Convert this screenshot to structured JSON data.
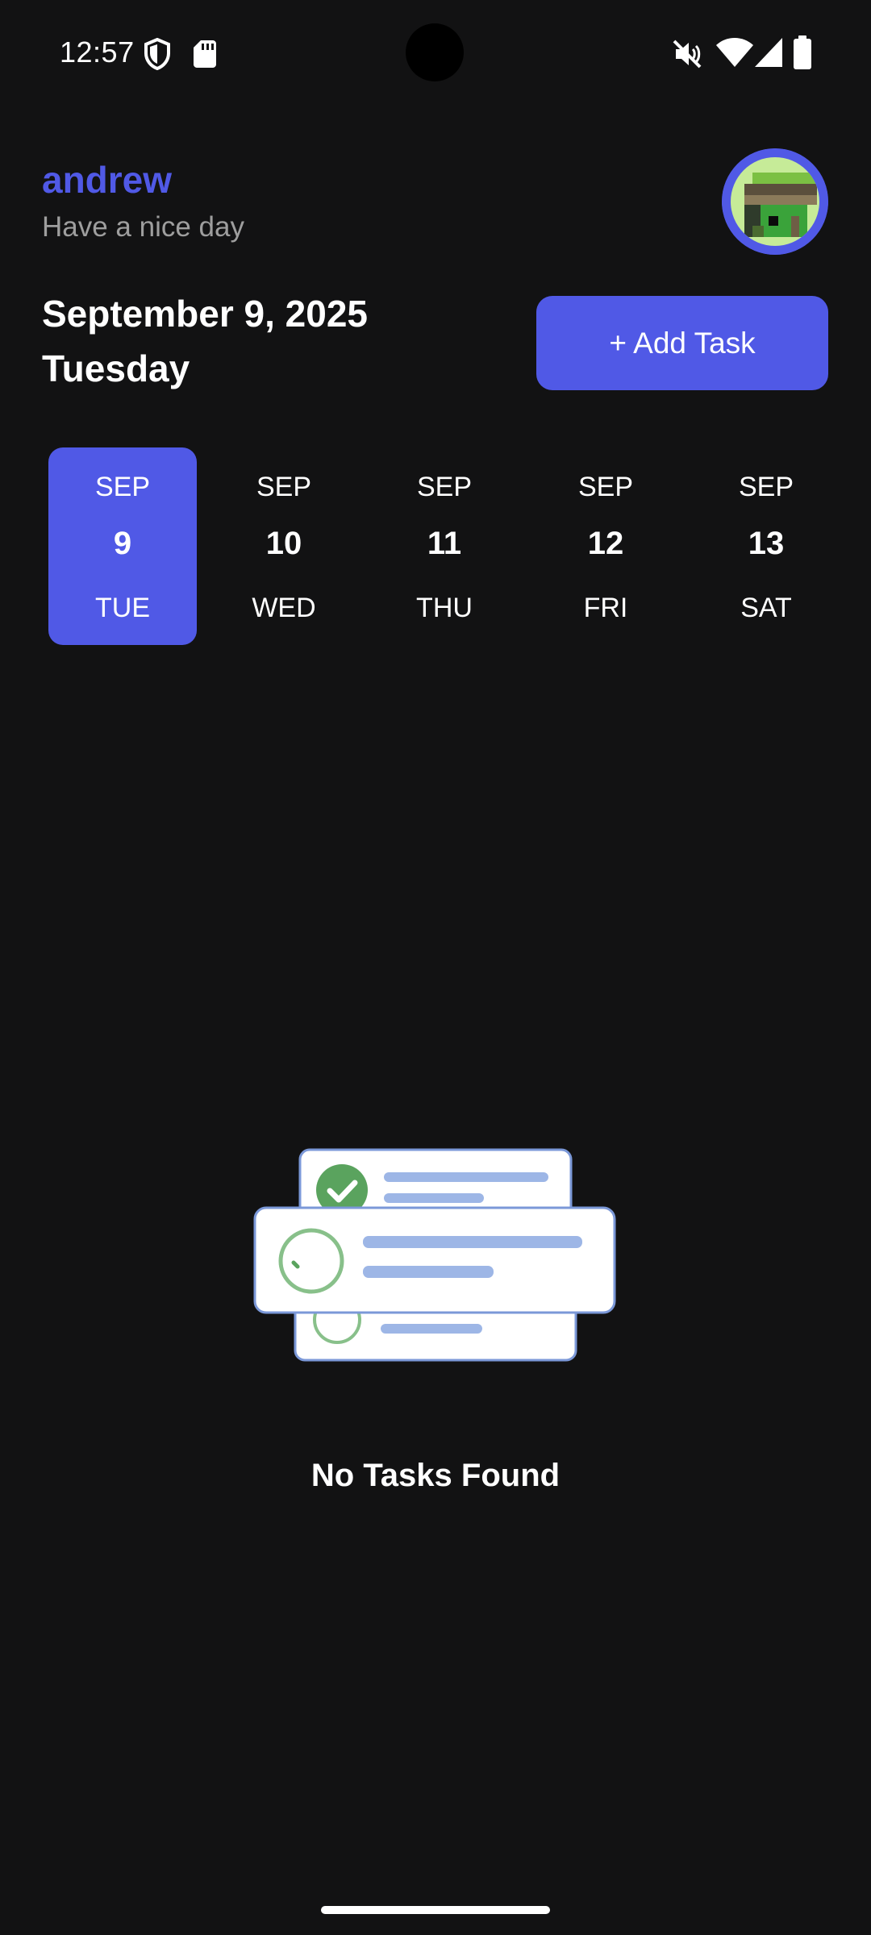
{
  "status_bar": {
    "time": "12:57",
    "icons": [
      "shield-icon",
      "sd-card-icon",
      "vibrate-off-icon",
      "wifi-icon",
      "signal-icon",
      "battery-icon"
    ]
  },
  "header": {
    "username": "andrew",
    "greeting": "Have a nice day",
    "avatar_icon": "pixel-avatar-icon"
  },
  "date": {
    "full": "September 9, 2025",
    "weekday": "Tuesday"
  },
  "add_task": {
    "label": "+ Add Task"
  },
  "days": [
    {
      "month": "SEP",
      "day": "9",
      "dow": "TUE",
      "selected": true
    },
    {
      "month": "SEP",
      "day": "10",
      "dow": "WED",
      "selected": false
    },
    {
      "month": "SEP",
      "day": "11",
      "dow": "THU",
      "selected": false
    },
    {
      "month": "SEP",
      "day": "12",
      "dow": "FRI",
      "selected": false
    },
    {
      "month": "SEP",
      "day": "13",
      "dow": "SAT",
      "selected": false
    }
  ],
  "empty_state": {
    "icon": "empty-tasks-illustration",
    "message": "No Tasks Found"
  },
  "colors": {
    "background": "#121213",
    "accent": "#5059e6",
    "muted_text": "#9e9e9e",
    "check_green": "#5aa35e",
    "list_line_blue": "#9db6e6"
  }
}
